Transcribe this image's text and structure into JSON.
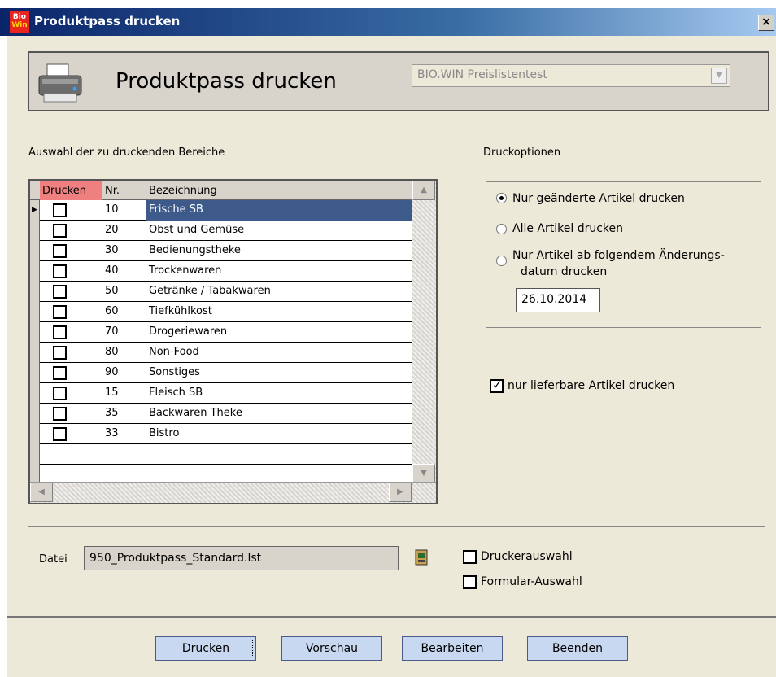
{
  "window": {
    "title": "Produktpass drucken",
    "close_label": "×",
    "logo_top": "Bio",
    "logo_bottom": "Win"
  },
  "header": {
    "title": "Produktpass drucken",
    "preisliste": "BIO.WIN Preislistentest",
    "select_arrow": "▼"
  },
  "grid": {
    "section_label": "Auswahl der zu druckenden Bereiche",
    "columns": [
      "Drucken",
      "Nr.",
      "Bezeichnung"
    ],
    "row_indicator": "▶",
    "rows": [
      {
        "checked": false,
        "nr": "10",
        "bezeichnung": "Frische SB"
      },
      {
        "checked": false,
        "nr": "20",
        "bezeichnung": "Obst und Gemüse"
      },
      {
        "checked": false,
        "nr": "30",
        "bezeichnung": "Bedienungstheke"
      },
      {
        "checked": false,
        "nr": "40",
        "bezeichnung": "Trockenwaren"
      },
      {
        "checked": false,
        "nr": "50",
        "bezeichnung": "Getränke / Tabakwaren"
      },
      {
        "checked": false,
        "nr": "60",
        "bezeichnung": "Tiefkühlkost"
      },
      {
        "checked": false,
        "nr": "70",
        "bezeichnung": "Drogeriewaren"
      },
      {
        "checked": false,
        "nr": "80",
        "bezeichnung": "Non-Food"
      },
      {
        "checked": false,
        "nr": "90",
        "bezeichnung": "Sonstiges"
      },
      {
        "checked": false,
        "nr": "15",
        "bezeichnung": "Fleisch SB"
      },
      {
        "checked": false,
        "nr": "35",
        "bezeichnung": "Backwaren  Theke"
      },
      {
        "checked": false,
        "nr": "33",
        "bezeichnung": "Bistro"
      }
    ],
    "selected_row": 0,
    "scroll": {
      "up": "▲",
      "down": "▼",
      "left": "◀",
      "right": "▶"
    }
  },
  "options": {
    "section_label": "Druckoptionen",
    "radio_1": "Nur geänderte Artikel drucken",
    "radio_2": "Alle Artikel drucken",
    "radio_3_line1": "Nur Artikel ab folgendem Änderungs-",
    "radio_3_line2": "datum drucken",
    "selected_radio": 1,
    "date": "26.10.2014",
    "lieferbar_label": "nur lieferbare Artikel drucken",
    "lieferbar_checked": true
  },
  "file": {
    "datei_label": "Datei",
    "datei_value": "950_Produktpass_Standard.lst",
    "druckerauswahl_label": "Druckerauswahl",
    "formular_label": "Formular-Auswahl"
  },
  "buttons": {
    "drucken": {
      "hotkey": "D",
      "rest": "rucken"
    },
    "vorschau": {
      "hotkey": "V",
      "rest": "orschau"
    },
    "bearbeiten": {
      "hotkey": "B",
      "rest": "earbeiten"
    },
    "beenden": {
      "hotkey": "",
      "rest": "Beenden"
    }
  },
  "colors": {
    "title_bar": "#0a246a",
    "dialog_bg": "#ece9d8",
    "selected_row": "#3d5a8a",
    "drucken_header": "#f08080",
    "button": "#c8d8f0"
  }
}
